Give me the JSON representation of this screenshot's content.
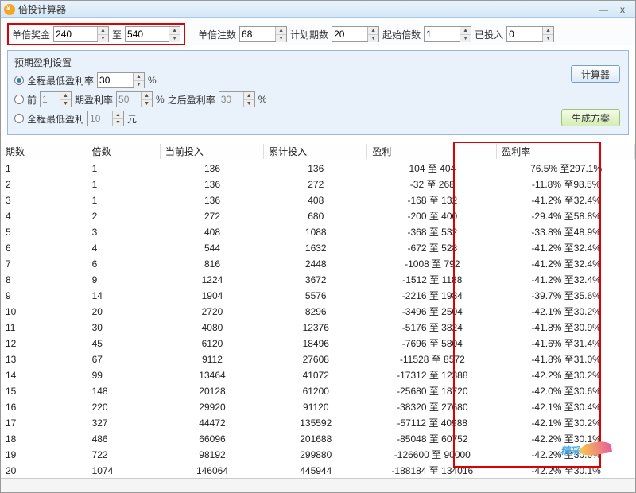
{
  "window": {
    "title": "倍投计算器",
    "minimize": "—",
    "close": "x"
  },
  "inputs": {
    "single_prize_label": "单倍奖金",
    "prize_from": "240",
    "to_label": "至",
    "prize_to": "540",
    "single_bets_label": "单倍注数",
    "single_bets": "68",
    "plan_periods_label": "计划期数",
    "plan_periods": "20",
    "start_mult_label": "起始倍数",
    "start_mult": "1",
    "invested_label": "已投入",
    "invested": "0"
  },
  "panel": {
    "title": "预期盈利设置",
    "opt1_label": "全程最低盈利率",
    "opt1_val": "30",
    "pct": "%",
    "opt2_label": "前",
    "opt2_n": "1",
    "opt2_mid": "期盈利率",
    "opt2_v1": "50",
    "opt2_pct1": "%",
    "opt2_after": "之后盈利率",
    "opt2_v2": "30",
    "opt2_pct2": "%",
    "opt3_label": "全程最低盈利",
    "opt3_val": "10",
    "yuan": "元",
    "btn_calc": "计算器",
    "btn_gen": "生成方案"
  },
  "headers": {
    "qs": "期数",
    "bs": "倍数",
    "dq": "当前投入",
    "lj": "累计投入",
    "yl": "盈利",
    "ylv": "盈利率"
  },
  "rows": [
    {
      "qs": "1",
      "bs": "1",
      "dq": "136",
      "lj": "136",
      "yl": "104 至 404",
      "ylv": "76.5% 至297.1%"
    },
    {
      "qs": "2",
      "bs": "1",
      "dq": "136",
      "lj": "272",
      "yl": "-32 至 268",
      "ylv": "-11.8% 至98.5%"
    },
    {
      "qs": "3",
      "bs": "1",
      "dq": "136",
      "lj": "408",
      "yl": "-168 至 132",
      "ylv": "-41.2% 至32.4%"
    },
    {
      "qs": "4",
      "bs": "2",
      "dq": "272",
      "lj": "680",
      "yl": "-200 至 400",
      "ylv": "-29.4% 至58.8%"
    },
    {
      "qs": "5",
      "bs": "3",
      "dq": "408",
      "lj": "1088",
      "yl": "-368 至 532",
      "ylv": "-33.8% 至48.9%"
    },
    {
      "qs": "6",
      "bs": "4",
      "dq": "544",
      "lj": "1632",
      "yl": "-672 至 528",
      "ylv": "-41.2% 至32.4%"
    },
    {
      "qs": "7",
      "bs": "6",
      "dq": "816",
      "lj": "2448",
      "yl": "-1008 至 792",
      "ylv": "-41.2% 至32.4%"
    },
    {
      "qs": "8",
      "bs": "9",
      "dq": "1224",
      "lj": "3672",
      "yl": "-1512 至 1188",
      "ylv": "-41.2% 至32.4%"
    },
    {
      "qs": "9",
      "bs": "14",
      "dq": "1904",
      "lj": "5576",
      "yl": "-2216 至 1984",
      "ylv": "-39.7% 至35.6%"
    },
    {
      "qs": "10",
      "bs": "20",
      "dq": "2720",
      "lj": "8296",
      "yl": "-3496 至 2504",
      "ylv": "-42.1% 至30.2%"
    },
    {
      "qs": "11",
      "bs": "30",
      "dq": "4080",
      "lj": "12376",
      "yl": "-5176 至 3824",
      "ylv": "-41.8% 至30.9%"
    },
    {
      "qs": "12",
      "bs": "45",
      "dq": "6120",
      "lj": "18496",
      "yl": "-7696 至 5804",
      "ylv": "-41.6% 至31.4%"
    },
    {
      "qs": "13",
      "bs": "67",
      "dq": "9112",
      "lj": "27608",
      "yl": "-11528 至 8572",
      "ylv": "-41.8% 至31.0%"
    },
    {
      "qs": "14",
      "bs": "99",
      "dq": "13464",
      "lj": "41072",
      "yl": "-17312 至 12388",
      "ylv": "-42.2% 至30.2%"
    },
    {
      "qs": "15",
      "bs": "148",
      "dq": "20128",
      "lj": "61200",
      "yl": "-25680 至 18720",
      "ylv": "-42.0% 至30.6%"
    },
    {
      "qs": "16",
      "bs": "220",
      "dq": "29920",
      "lj": "91120",
      "yl": "-38320 至 27680",
      "ylv": "-42.1% 至30.4%"
    },
    {
      "qs": "17",
      "bs": "327",
      "dq": "44472",
      "lj": "135592",
      "yl": "-57112 至 40988",
      "ylv": "-42.1% 至30.2%"
    },
    {
      "qs": "18",
      "bs": "486",
      "dq": "66096",
      "lj": "201688",
      "yl": "-85048 至 60752",
      "ylv": "-42.2% 至30.1%"
    },
    {
      "qs": "19",
      "bs": "722",
      "dq": "98192",
      "lj": "299880",
      "yl": "-126600 至 90000",
      "ylv": "-42.2% 至30.0%"
    },
    {
      "qs": "20",
      "bs": "1074",
      "dq": "146064",
      "lj": "445944",
      "yl": "-188184 至 134016",
      "ylv": "-42.2% 至30.1%"
    }
  ],
  "watermark": "精采"
}
